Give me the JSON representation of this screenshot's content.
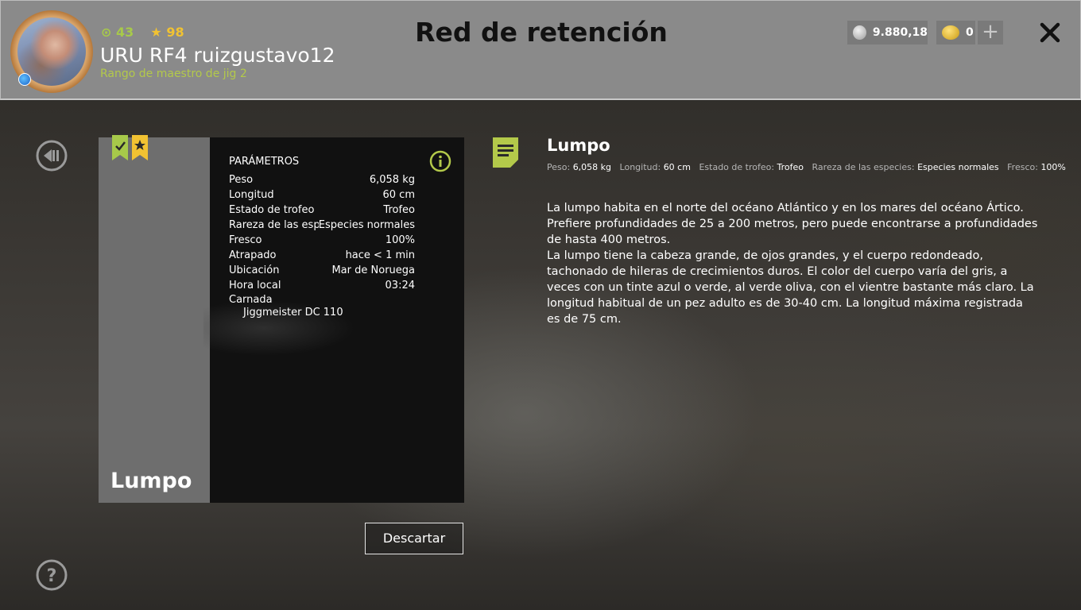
{
  "header": {
    "title": "Red de retención",
    "player": {
      "level": "43",
      "stars": "98",
      "name": "URU RF4 ruizgustavo12",
      "rank": "Rango de maestro de jig 2"
    },
    "currency": {
      "silver": "9.880,18",
      "gold": "0"
    },
    "icons": {
      "silver": "silver-coins-icon",
      "gold": "gold-coins-icon",
      "add": "plus-icon",
      "close": "close-icon"
    }
  },
  "card": {
    "name": "Lumpo",
    "params_title": "PARÁMETROS",
    "params": [
      {
        "label": "Peso",
        "value": "6,058 kg"
      },
      {
        "label": "Longitud",
        "value": "60 cm"
      },
      {
        "label": "Estado de trofeo",
        "value": "Trofeo"
      },
      {
        "label": "Rareza de las especies",
        "value": "Especies normales"
      },
      {
        "label": "Fresco",
        "value": "100%"
      },
      {
        "label": "Atrapado",
        "value": "hace < 1 min"
      },
      {
        "label": "Ubicación",
        "value": "Mar de Noruega"
      },
      {
        "label": "Hora local",
        "value": "03:24"
      }
    ],
    "bait_label": "Carnada",
    "bait_value": "Jiggmeister DC 110",
    "badges": [
      "check-badge-icon",
      "star-badge-icon"
    ],
    "discard_label": "Descartar"
  },
  "description": {
    "title": "Lumpo",
    "summary": [
      {
        "label": "Peso:",
        "value": "6,058 kg"
      },
      {
        "label": "Longitud:",
        "value": "60 cm"
      },
      {
        "label": "Estado de trofeo:",
        "value": "Trofeo"
      },
      {
        "label": "Rareza de las especies:",
        "value": "Especies normales"
      },
      {
        "label": "Fresco:",
        "value": "100%"
      }
    ],
    "paragraphs": [
      "La lumpo habita en el norte del océano Atlántico y en los mares del océano Ártico. Prefiere profundidades de 25 a 200 metros, pero puede encontrarse a profundidades de hasta 400 metros.",
      "La lumpo tiene la cabeza grande, de ojos grandes, y el cuerpo redondeado, tachonado de hileras de crecimientos duros. El color del cuerpo varía del gris, a veces con un tinte azul o verde, al verde oliva, con el vientre bastante más claro. La longitud habitual de un pez adulto es de 30-40 cm. La longitud máxima registrada es de 75 cm."
    ]
  },
  "colors": {
    "accent_green": "#b3c94a",
    "star_yellow": "#f1c232",
    "header_bg": "#8a8a8a"
  }
}
